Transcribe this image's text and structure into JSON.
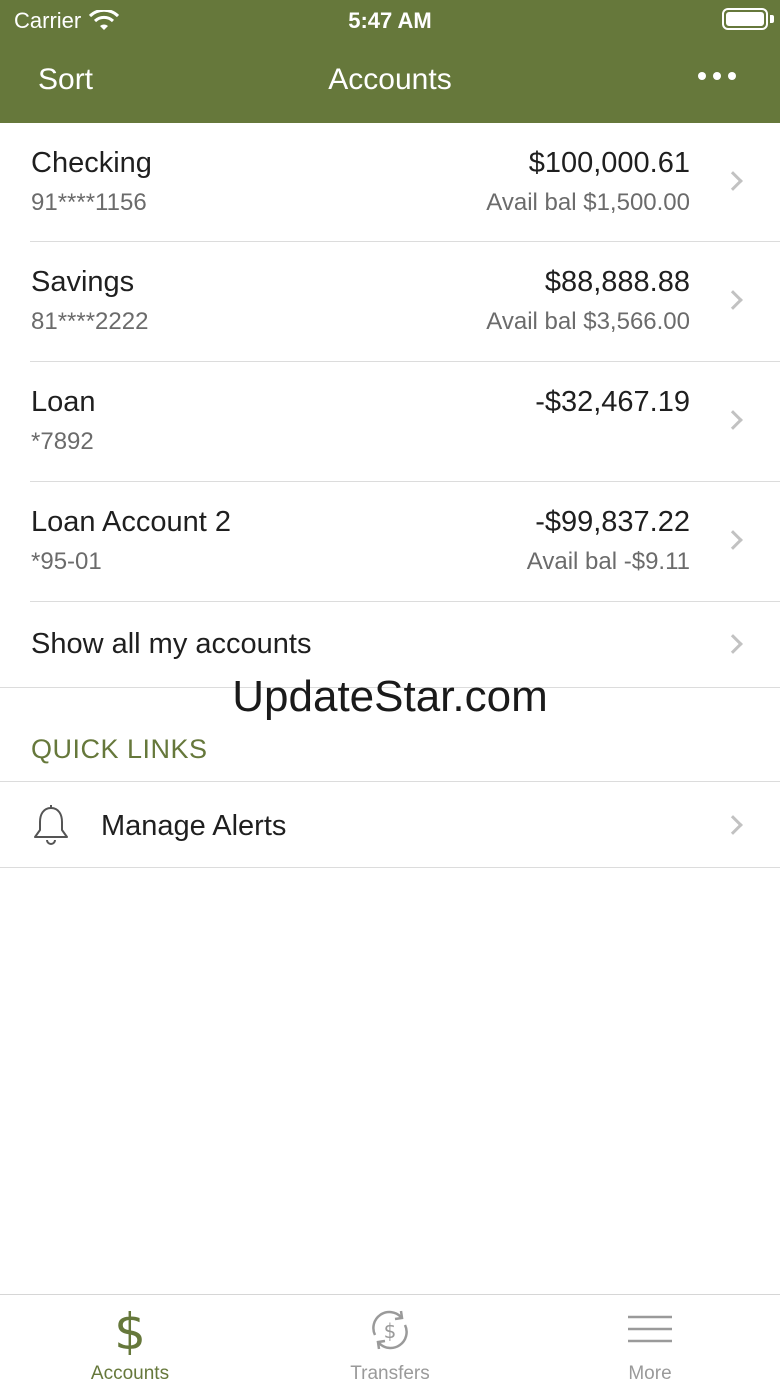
{
  "status_bar": {
    "carrier": "Carrier",
    "time": "5:47 AM"
  },
  "nav": {
    "left_label": "Sort",
    "title": "Accounts",
    "more_icon": "ellipsis-icon"
  },
  "accounts": [
    {
      "name": "Checking",
      "number": "91****1156",
      "balance": "$100,000.61",
      "available": "Avail bal $1,500.00"
    },
    {
      "name": "Savings",
      "number": "81****2222",
      "balance": "$88,888.88",
      "available": "Avail bal $3,566.00"
    },
    {
      "name": "Loan",
      "number": "*7892",
      "balance": "-$32,467.19",
      "available": ""
    },
    {
      "name": "Loan Account 2",
      "number": "*95-01",
      "balance": "-$99,837.22",
      "available": "Avail bal -$9.11"
    }
  ],
  "show_all": {
    "label": "Show all my accounts"
  },
  "watermark": "UpdateStar.com",
  "quick_links": {
    "heading": "QUICK LINKS",
    "items": [
      {
        "label": "Manage Alerts",
        "icon": "bell-icon"
      }
    ]
  },
  "tabbar": {
    "tabs": [
      {
        "label": "Accounts",
        "icon": "dollar-icon",
        "active": true
      },
      {
        "label": "Transfers",
        "icon": "transfer-icon",
        "active": false
      },
      {
        "label": "More",
        "icon": "menu-icon",
        "active": false
      }
    ]
  },
  "colors": {
    "brand": "#66783b",
    "inactive_tab": "#9a9a9a",
    "secondary_text": "#6b6b6b"
  }
}
